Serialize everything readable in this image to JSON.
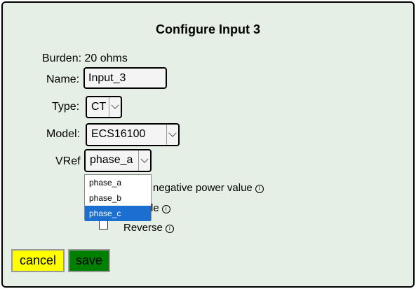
{
  "dialog": {
    "title": "Configure Input 3",
    "burden": "Burden: 20 ohms",
    "name": {
      "label": "Name:",
      "value": "Input_3"
    },
    "type": {
      "label": "Type:",
      "value": "CT"
    },
    "model": {
      "label": "Model:",
      "value": "ECS16100"
    },
    "vref": {
      "label": "VRef",
      "value": "phase_a",
      "options": [
        "phase_a",
        "phase_b",
        "phase_c"
      ],
      "highlighted": "phase_c"
    },
    "options": [
      {
        "label": "negative power value",
        "icon": "info-icon"
      },
      {
        "label": "le",
        "icon": "info-icon"
      },
      {
        "label": "Reverse",
        "icon": "info-icon"
      }
    ],
    "buttons": {
      "cancel": "cancel",
      "save": "save"
    }
  },
  "colors": {
    "dialog_bg": "#e6efe6",
    "cancel_bg": "#ffff00",
    "save_bg": "#008000",
    "highlight": "#1a6fd1"
  }
}
